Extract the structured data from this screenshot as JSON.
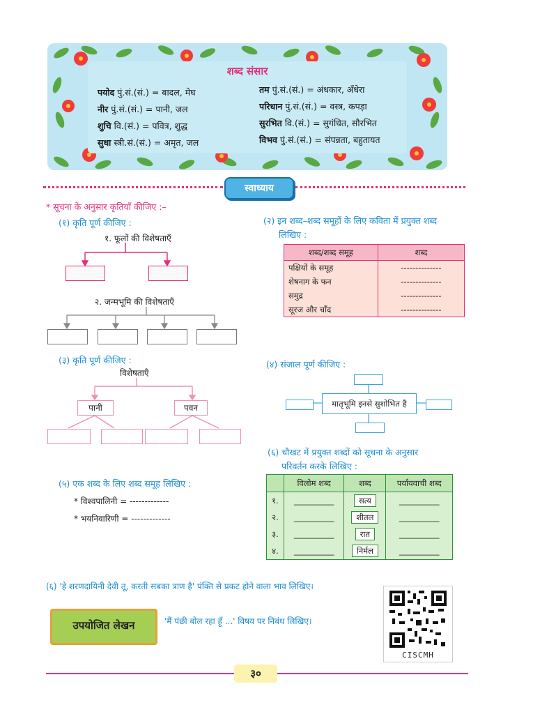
{
  "vocab": {
    "title": "शब्द संसार",
    "left": [
      {
        "word": "पयोद",
        "rest": " पुं.सं.(सं.) = बादल, मेघ"
      },
      {
        "word": "नीर",
        "rest": " पुं.सं.(सं.) = पानी, जल"
      },
      {
        "word": "शुचि",
        "rest": " वि.(सं.) = पवित्र, शुद्ध"
      },
      {
        "word": "सुधा",
        "rest": " स्त्री.सं.(सं.) = अमृत, जल"
      }
    ],
    "right": [
      {
        "word": "तम",
        "rest": " पुं.सं.(सं.) = अंधकार, अँधेरा"
      },
      {
        "word": "परिधान",
        "rest": " पुं.सं.(सं.) = वस्त्र, कपड़ा"
      },
      {
        "word": "सुरभित",
        "rest": " वि.(सं.) = सुगंधित, सौरभित"
      },
      {
        "word": "विभव",
        "rest": " पुं.सं.(सं.) = संपन्नता, बहुतायत"
      }
    ]
  },
  "section_badge": "स्वाध्याय",
  "instruction": "* सूचना के अनुसार कृतियाँ कीजिए :–",
  "q1": {
    "title": "(१) कृति पूर्ण कीजिए :",
    "sub1": "१. फूलों की विशेषताएँ",
    "sub2": "२. जन्मभूमि की विशेषताएँ"
  },
  "q2": {
    "title1": "(२) इन शब्द–शब्द समूहों के लिए कविता में प्रयुक्त शब्द",
    "title2": "लिखिए :",
    "headers": [
      "शब्द/शब्द समूह",
      "शब्द"
    ],
    "rows": [
      "पक्षियों के समूह",
      "शेषनाग के फन",
      "समुद्र",
      "सूरज और चाँद"
    ],
    "blank": "--------------"
  },
  "q3": {
    "title": "(३) कृति पूर्ण कीजिए :",
    "root": "विशेषताएँ",
    "left": "पानी",
    "right": "पवन"
  },
  "q4": {
    "title": "(४) संजाल पूर्ण कीजिए :",
    "center": "मातृभूमि इनसे सुशोभित है"
  },
  "q5": {
    "title": "(५) एक शब्द के लिए शब्द समूह लिखिए :",
    "items": [
      "* विश्वपालिनी = -------------",
      "* भयनिवारिणी = -------------"
    ]
  },
  "q6": {
    "title1": "(६)  चौखट में प्रयुक्त शब्दों को सूचना के अनुसार",
    "title2": "परिवर्तन करके लिखिए :",
    "headers": [
      "",
      "विलोम शब्द",
      "शब्द",
      "पर्यायवाची शब्द"
    ],
    "rows": [
      {
        "num": "१.",
        "word": "सत्य"
      },
      {
        "num": "२.",
        "word": "शीतल"
      },
      {
        "num": "३.",
        "word": "रात"
      },
      {
        "num": "४.",
        "word": "निर्मल"
      }
    ],
    "blank": "__________"
  },
  "q7": "(६) 'हे शरणदायिनी देवी तू, करती सबका त्राण है' पंक्ति से प्रकट होने वाला भाव लिखिए।",
  "upayojit": {
    "label": "उपयोजित लेखन",
    "text": "'मैं पंछी बोल रहा हूँ ...' विषय पर निबंध लिखिए।"
  },
  "qr_caption": "CISCMH",
  "page_number": "३०",
  "colors": {
    "pink": "#e0317a",
    "blue": "#1b8ccf",
    "green": "#2f8f3a",
    "sky": "#bfe6f2"
  }
}
